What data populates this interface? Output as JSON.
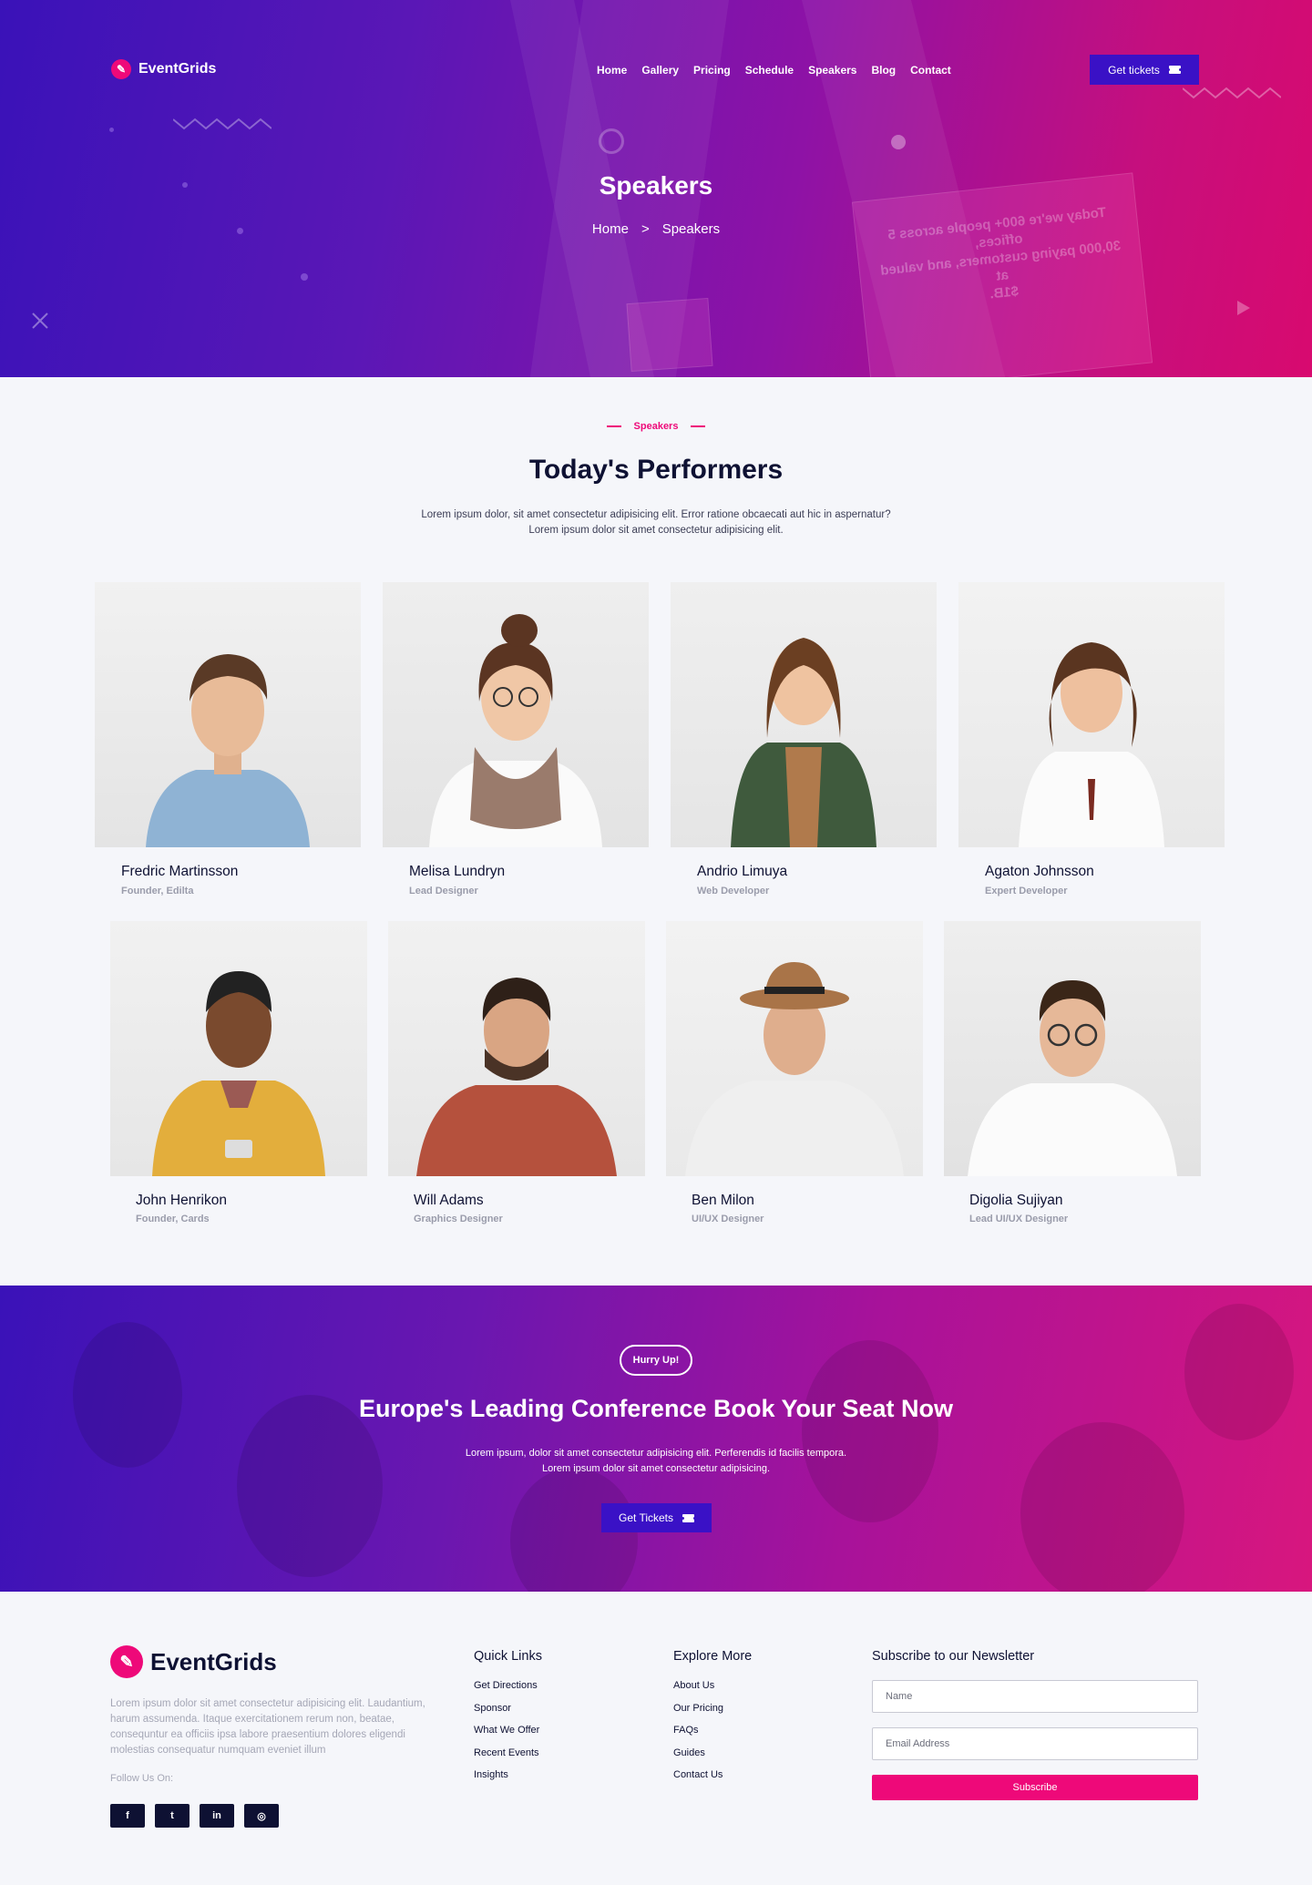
{
  "brand": {
    "name": "EventGrids",
    "accent": "#ee0979",
    "dark": "#0e1133",
    "button": "#3a11c6"
  },
  "nav": {
    "items": [
      "Home",
      "Gallery",
      "Pricing",
      "Schedule",
      "Speakers",
      "Blog",
      "Contact"
    ],
    "cta_label": "Get tickets",
    "cta_icon": "ticket-icon"
  },
  "hero": {
    "title": "Speakers",
    "breadcrumb": {
      "home": "Home",
      "separator": ">",
      "current": "Speakers"
    },
    "backdrop_text": [
      "Today we're 600+ people across 5 offices,",
      "30,000 paying customers, and valued at",
      "$1B."
    ]
  },
  "speakers_section": {
    "eyebrow": "Speakers",
    "title": "Today's Performers",
    "desc_line1": "Lorem ipsum dolor, sit amet consectetur adipisicing elit. Error ratione obcaecati aut hic in aspernatur?",
    "desc_line2": "Lorem ipsum dolor sit amet consectetur adipisicing elit.",
    "speakers": [
      {
        "name": "Fredric Martinsson",
        "role": "Founder, Edilta"
      },
      {
        "name": "Melisa Lundryn",
        "role": "Lead Designer"
      },
      {
        "name": "Andrio Limuya",
        "role": "Web Developer"
      },
      {
        "name": "Agaton Johnsson",
        "role": "Expert Developer"
      },
      {
        "name": "John Henrikon",
        "role": "Founder, Cards"
      },
      {
        "name": "Will Adams",
        "role": "Graphics Designer"
      },
      {
        "name": "Ben Milon",
        "role": "UI/UX Designer"
      },
      {
        "name": "Digolia Sujiyan",
        "role": "Lead UI/UX Designer"
      }
    ]
  },
  "cta": {
    "badge": "Hurry Up!",
    "title": "Europe's Leading Conference Book Your Seat Now",
    "desc_line1": "Lorem ipsum, dolor sit amet consectetur adipisicing elit. Perferendis id facilis tempora.",
    "desc_line2": "Lorem ipsum dolor sit amet consectetur adipisicing.",
    "button_label": "Get Tickets"
  },
  "footer": {
    "brand": "EventGrids",
    "about": "Lorem ipsum dolor sit amet consectetur adipisicing elit. Laudantium, harum assumenda. Itaque exercitationem rerum non, beatae, consequntur ea officiis ipsa labore praesentium dolores eligendi molestias consequatur numquam eveniet illum",
    "follow_label": "Follow Us On:",
    "socials": [
      {
        "icon": "facebook-icon",
        "glyph": "f"
      },
      {
        "icon": "twitter-icon",
        "glyph": "t"
      },
      {
        "icon": "linkedin-icon",
        "glyph": "in"
      },
      {
        "icon": "instagram-icon",
        "glyph": "◎"
      }
    ],
    "quick_links": {
      "title": "Quick Links",
      "items": [
        "Get Directions",
        "Sponsor",
        "What We Offer",
        "Recent Events",
        "Insights"
      ]
    },
    "explore_more": {
      "title": "Explore More",
      "items": [
        "About Us",
        "Our Pricing",
        "FAQs",
        "Guides",
        "Contact Us"
      ]
    },
    "newsletter": {
      "title": "Subscribe to our Newsletter",
      "name_placeholder": "Name",
      "email_placeholder": "Email Address",
      "button_label": "Subscribe"
    }
  }
}
